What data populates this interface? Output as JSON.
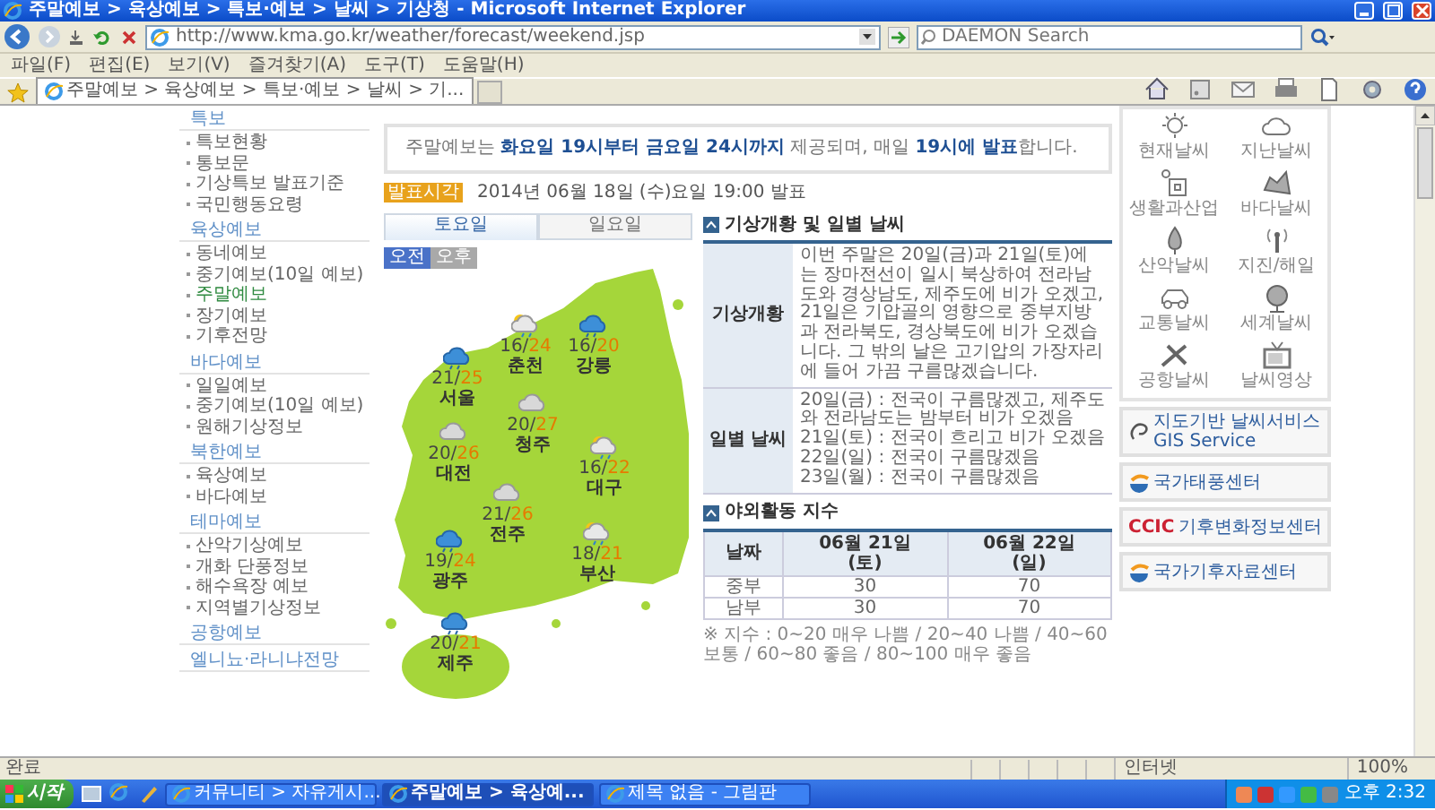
{
  "window": {
    "title": "주말예보 > 육상예보 > 특보·예보 > 날씨 > 기상청 - Microsoft Internet Explorer"
  },
  "address_bar": {
    "url": "http://www.kma.go.kr/weather/forecast/weekend.jsp"
  },
  "search": {
    "placeholder": "DAEMON Search"
  },
  "menu": [
    "파일(F)",
    "편집(E)",
    "보기(V)",
    "즐겨찾기(A)",
    "도구(T)",
    "도움말(H)"
  ],
  "browser_tab": {
    "title": "주말예보 > 육상예보 > 특보·예보 > 날씨 > 기..."
  },
  "sidebar": {
    "items": [
      {
        "label": "특보",
        "kind": "header",
        "selected": false
      },
      {
        "label": "특보현황",
        "kind": "link",
        "selected": false
      },
      {
        "label": "통보문",
        "kind": "link",
        "selected": false
      },
      {
        "label": "기상특보 발표기준",
        "kind": "link",
        "selected": false
      },
      {
        "label": "국민행동요령",
        "kind": "link",
        "selected": false
      },
      {
        "label": "육상예보",
        "kind": "header",
        "selected": false
      },
      {
        "label": "동네예보",
        "kind": "link",
        "selected": false
      },
      {
        "label": "중기예보(10일 예보)",
        "kind": "link",
        "selected": false
      },
      {
        "label": "주말예보",
        "kind": "link",
        "selected": true
      },
      {
        "label": "장기예보",
        "kind": "link",
        "selected": false
      },
      {
        "label": "기후전망",
        "kind": "link",
        "selected": false
      },
      {
        "label": "바다예보",
        "kind": "header",
        "selected": false
      },
      {
        "label": "일일예보",
        "kind": "link",
        "selected": false
      },
      {
        "label": "중기예보(10일 예보)",
        "kind": "link",
        "selected": false
      },
      {
        "label": "원해기상정보",
        "kind": "link",
        "selected": false
      },
      {
        "label": "북한예보",
        "kind": "header",
        "selected": false
      },
      {
        "label": "육상예보",
        "kind": "link",
        "selected": false
      },
      {
        "label": "바다예보",
        "kind": "link",
        "selected": false
      },
      {
        "label": "테마예보",
        "kind": "header",
        "selected": false
      },
      {
        "label": "산악기상예보",
        "kind": "link",
        "selected": false
      },
      {
        "label": "개화 단풍정보",
        "kind": "link",
        "selected": false
      },
      {
        "label": "해수욕장 예보",
        "kind": "link",
        "selected": false
      },
      {
        "label": "지역별기상정보",
        "kind": "link",
        "selected": false
      },
      {
        "label": "공항예보",
        "kind": "header",
        "selected": false
      },
      {
        "label": "엘니뇨·라니냐전망",
        "kind": "header",
        "selected": false
      }
    ]
  },
  "notice": "주말예보는 **화요일 19시부터 금요일 24시까지** 제공되며, 매일 **19시에 발표**합니다.",
  "announce": {
    "badge": "발표시각",
    "time": "2014년 06월 18일 (수)요일 19:00 발표"
  },
  "day_tabs": [
    {
      "label": "토요일",
      "selected": true
    },
    {
      "label": "일요일",
      "selected": false
    }
  ],
  "period_toggle": [
    {
      "label": "오전",
      "selected": true
    },
    {
      "label": "오후",
      "selected": false
    }
  ],
  "map": {
    "cities": [
      {
        "name": "서울",
        "temp": "21/25"
      },
      {
        "name": "춘천",
        "temp": "16/24"
      },
      {
        "name": "강릉",
        "temp": "16/20"
      },
      {
        "name": "청주",
        "temp": "20/27"
      },
      {
        "name": "대전",
        "temp": "20/26"
      },
      {
        "name": "대구",
        "temp": "16/22"
      },
      {
        "name": "전주",
        "temp": "21/26"
      },
      {
        "name": "광주",
        "temp": "19/24"
      },
      {
        "name": "부산",
        "temp": "18/21"
      },
      {
        "name": "제주",
        "temp": "20/21"
      }
    ]
  },
  "overview": {
    "title": "기상개황 및 일별 날씨",
    "rows": [
      {
        "label": "기상개황",
        "lines": [
          "이번 주말은 20일(금)과 21일(토)에는 장마전선이 일시 북상하여 전라남도와 경상남도, 제주도에 비가 오겠고, 21일은 기압골의 영향으로 중부지방과 전라북도, 경상북도에 비가 오겠습니다. 그 밖의 날은 고기압의 가장자리에 들어 가끔 구름많겠습니다."
        ]
      },
      {
        "label": "일별 날씨",
        "lines": [
          "20일(금) : 전국이 구름많겠고, 제주도와 전라남도는 밤부터 비가 오겠음",
          "21일(토) : 전국이 흐리고 비가 오겠음",
          "22일(일) : 전국이 구름많겠음",
          "23일(월) : 전국이 구름많겠음"
        ]
      }
    ]
  },
  "outdoor": {
    "title": "야외활동 지수",
    "columns": [
      "날짜",
      "06월 21일 (토)",
      "06월 22일 (일)"
    ],
    "rows": [
      [
        "중부",
        "30",
        "70"
      ],
      [
        "남부",
        "30",
        "70"
      ]
    ],
    "note": "※ 지수 : 0~20 매우 나쁨 / 20~40 나쁨 / 40~60 보통 / 60~80 좋음 / 80~100 매우 좋음"
  },
  "quick_links": [
    "현재날씨",
    "지난날씨",
    "생활과산업",
    "바다날씨",
    "산악날씨",
    "지진/해일",
    "교통날씨",
    "세계날씨",
    "공항날씨",
    "날씨영상"
  ],
  "banners": [
    {
      "text": "지도기반 날씨서비스",
      "subtext": "GIS Service"
    },
    {
      "text": "국가태풍센터"
    },
    {
      "logo": "CCIC",
      "text": "기후변화정보센터"
    },
    {
      "text": "국가기후자료센터"
    }
  ],
  "status_bar": {
    "text": "완료",
    "zone": "인터넷",
    "zoom": "100%"
  },
  "taskbar": {
    "start": "시작",
    "tasks": [
      {
        "label": "커뮤니티 > 자유게시...",
        "selected": false
      },
      {
        "label": "주말예보 > 육상예...",
        "selected": true
      },
      {
        "label": "제목 없음 - 그림판",
        "selected": false
      }
    ],
    "clock": "오후 2:32"
  }
}
